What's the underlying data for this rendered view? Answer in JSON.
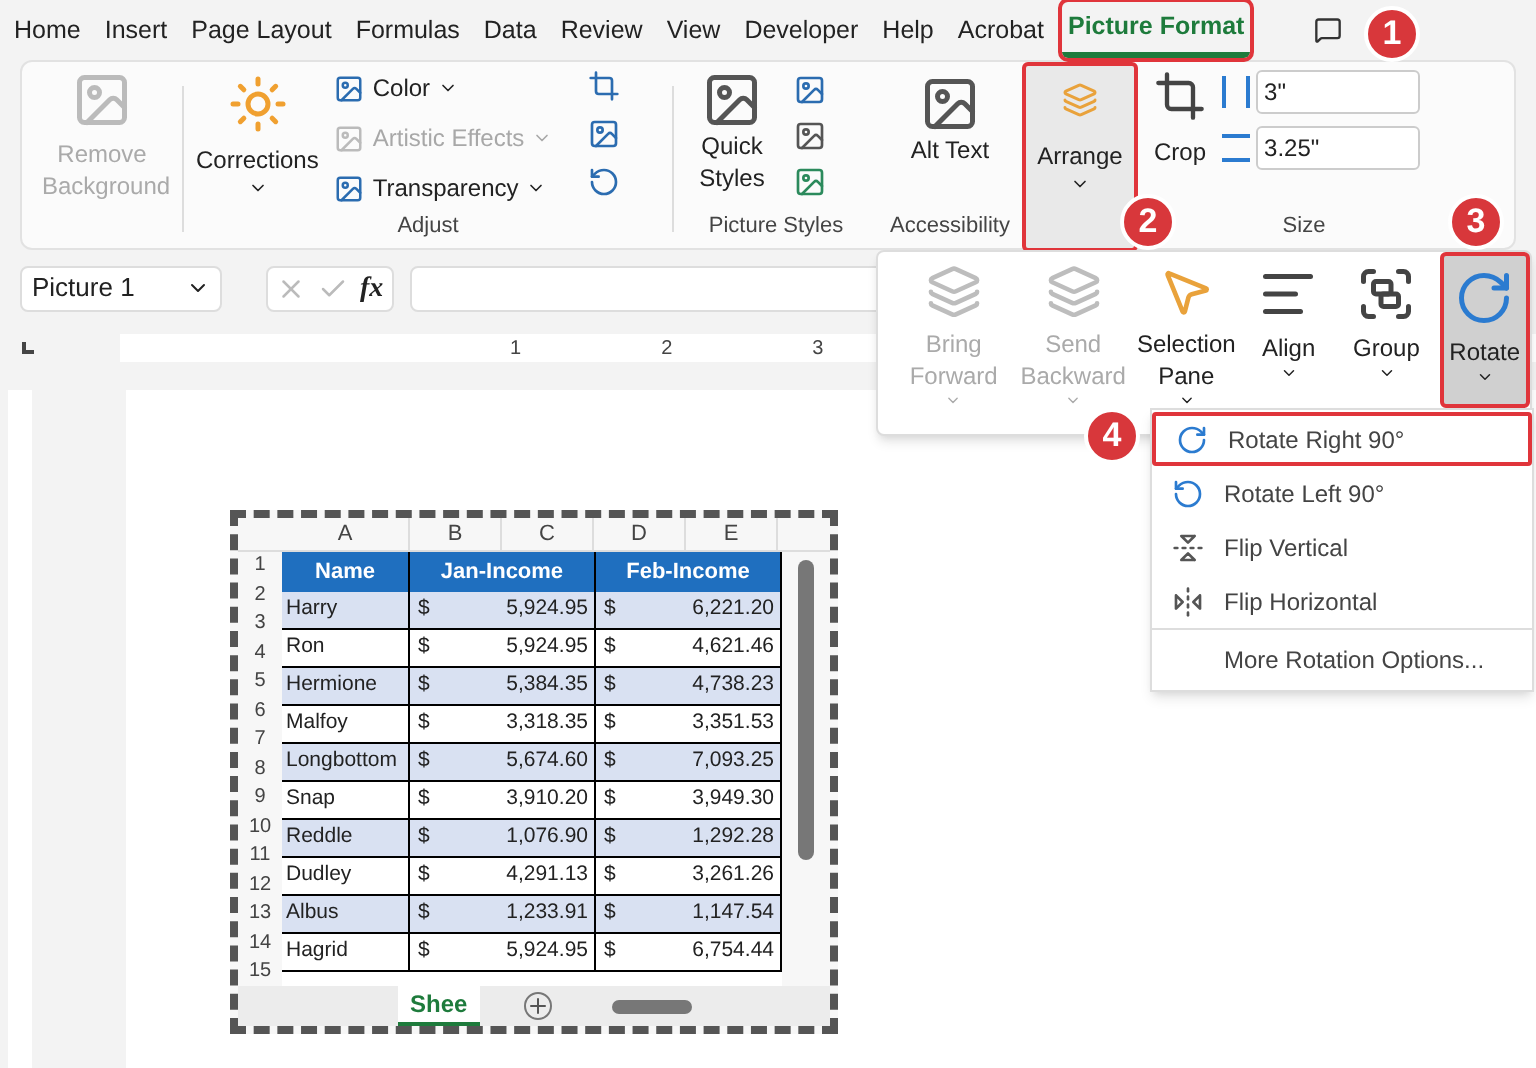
{
  "tabs": [
    {
      "label": "Home",
      "selected": false,
      "highlighted": false
    },
    {
      "label": "Insert",
      "selected": false,
      "highlighted": false
    },
    {
      "label": "Page Layout",
      "selected": false,
      "highlighted": false
    },
    {
      "label": "Formulas",
      "selected": false,
      "highlighted": false
    },
    {
      "label": "Data",
      "selected": false,
      "highlighted": false
    },
    {
      "label": "Review",
      "selected": false,
      "highlighted": false
    },
    {
      "label": "View",
      "selected": false,
      "highlighted": false
    },
    {
      "label": "Developer",
      "selected": false,
      "highlighted": false
    },
    {
      "label": "Help",
      "selected": false,
      "highlighted": false
    },
    {
      "label": "Acrobat",
      "selected": false,
      "highlighted": false
    },
    {
      "label": "Picture Format",
      "selected": true,
      "highlighted": true
    }
  ],
  "ribbon": {
    "remove_background": {
      "label": "Remove Background",
      "disabled": true
    },
    "adjust": {
      "label": "Adjust",
      "corrections": "Corrections",
      "items": [
        {
          "label": "Color",
          "disabled": false
        },
        {
          "label": "Artistic Effects",
          "disabled": true
        },
        {
          "label": "Transparency",
          "disabled": false
        }
      ]
    },
    "picture_styles": {
      "label": "Picture Styles",
      "quick_styles": "Quick Styles"
    },
    "accessibility": {
      "label": "Accessibility",
      "alt_text": "Alt Text"
    },
    "arrange": {
      "label": "Arrange",
      "highlighted": true
    },
    "size": {
      "label": "Size",
      "crop": "Crop",
      "height": "3\"",
      "width": "3.25\""
    }
  },
  "formula_bar": {
    "name_box": "Picture 1",
    "fx": "fx"
  },
  "ruler": {
    "numbers": [
      "1",
      "2",
      "3"
    ]
  },
  "arrange_panel": {
    "buttons": [
      {
        "kind": "front",
        "label": "Bring Forward",
        "disabled": true,
        "highlighted": false
      },
      {
        "kind": "back",
        "label": "Send Backward",
        "disabled": true,
        "highlighted": false
      },
      {
        "kind": "pane",
        "label": "Selection Pane",
        "disabled": false,
        "highlighted": false
      },
      {
        "kind": "align",
        "label": "Align",
        "disabled": false,
        "highlighted": false
      },
      {
        "kind": "group",
        "label": "Group",
        "disabled": false,
        "highlighted": false
      },
      {
        "kind": "rotate",
        "label": "Rotate",
        "disabled": false,
        "highlighted": true
      }
    ]
  },
  "rotate_menu": {
    "items": [
      {
        "kind": "right",
        "label": "Rotate Right 90°",
        "highlighted": true
      },
      {
        "kind": "left",
        "label": "Rotate Left 90°",
        "highlighted": false
      },
      {
        "kind": "vertical",
        "label": "Flip Vertical",
        "highlighted": false
      },
      {
        "kind": "horizontal",
        "label": "Flip Horizontal",
        "highlighted": false
      },
      {
        "kind": "more",
        "label": "More Rotation Options...",
        "highlighted": false
      }
    ]
  },
  "sheet": {
    "columns": [
      "A",
      "B",
      "C",
      "D",
      "E"
    ],
    "row_numbers": [
      "1",
      "2",
      "3",
      "4",
      "5",
      "6",
      "7",
      "8",
      "9",
      "10",
      "11",
      "12",
      "13",
      "14",
      "15"
    ],
    "header": [
      "Name",
      "Jan-Income",
      "Feb-Income"
    ],
    "rows": [
      [
        "Harry",
        "$",
        "5,924.95",
        "$",
        "6,221.20"
      ],
      [
        "Ron",
        "$",
        "5,924.95",
        "$",
        "4,621.46"
      ],
      [
        "Hermione",
        "$",
        "5,384.35",
        "$",
        "4,738.23"
      ],
      [
        "Malfoy",
        "$",
        "3,318.35",
        "$",
        "3,351.53"
      ],
      [
        "Longbottom",
        "$",
        "5,674.60",
        "$",
        "7,093.25"
      ],
      [
        "Snap",
        "$",
        "3,910.20",
        "$",
        "3,949.30"
      ],
      [
        "Reddle",
        "$",
        "1,076.90",
        "$",
        "1,292.28"
      ],
      [
        "Dudley",
        "$",
        "4,291.13",
        "$",
        "3,261.26"
      ],
      [
        "Albus",
        "$",
        "1,233.91",
        "$",
        "1,147.54"
      ],
      [
        "Hagrid",
        "$",
        "5,924.95",
        "$",
        "6,754.44"
      ]
    ],
    "sheet_tab": "Shee"
  },
  "callouts": [
    "1",
    "2",
    "3",
    "4"
  ]
}
